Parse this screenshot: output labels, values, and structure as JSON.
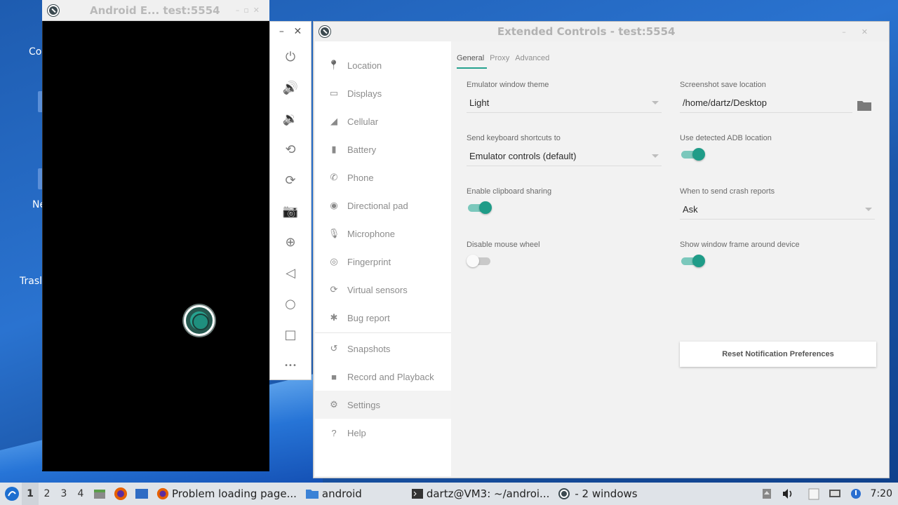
{
  "desktop": {
    "icon_labels": [
      "Co",
      "Ne",
      "Trasl"
    ]
  },
  "emulator": {
    "title": "Android E... test:5554",
    "toolbar": {
      "minimize": "–",
      "close": "✕",
      "buttons": [
        {
          "name": "power-icon",
          "glyph": "⏻"
        },
        {
          "name": "volume-up-icon",
          "glyph": "🔊"
        },
        {
          "name": "volume-down-icon",
          "glyph": "🔉"
        },
        {
          "name": "rotate-left-icon",
          "glyph": "⟲"
        },
        {
          "name": "rotate-right-icon",
          "glyph": "⟳"
        },
        {
          "name": "camera-icon",
          "glyph": "📷"
        },
        {
          "name": "zoom-icon",
          "glyph": "⊕"
        },
        {
          "name": "back-icon",
          "glyph": "◁"
        },
        {
          "name": "home-icon",
          "glyph": "○"
        },
        {
          "name": "overview-icon",
          "glyph": "□"
        },
        {
          "name": "more-icon",
          "glyph": "•••"
        }
      ]
    }
  },
  "extended": {
    "title": "Extended Controls - test:5554",
    "nav": [
      {
        "label": "Location",
        "icon": "location-icon",
        "glyph": "📍"
      },
      {
        "label": "Displays",
        "icon": "display-icon",
        "glyph": "▭"
      },
      {
        "label": "Cellular",
        "icon": "signal-icon",
        "glyph": "◢"
      },
      {
        "label": "Battery",
        "icon": "battery-icon",
        "glyph": "▮"
      },
      {
        "label": "Phone",
        "icon": "phone-icon",
        "glyph": "✆"
      },
      {
        "label": "Directional pad",
        "icon": "dpad-icon",
        "glyph": "◉"
      },
      {
        "label": "Microphone",
        "icon": "microphone-icon",
        "glyph": "🎙"
      },
      {
        "label": "Fingerprint",
        "icon": "fingerprint-icon",
        "glyph": "◎"
      },
      {
        "label": "Virtual sensors",
        "icon": "sensors-icon",
        "glyph": "⟳"
      },
      {
        "label": "Bug report",
        "icon": "bug-icon",
        "glyph": "✱"
      },
      {
        "label": "Snapshots",
        "icon": "snapshot-icon",
        "glyph": "↺"
      },
      {
        "label": "Record and Playback",
        "icon": "record-icon",
        "glyph": "■"
      },
      {
        "label": "Settings",
        "icon": "gear-icon",
        "glyph": "⚙"
      },
      {
        "label": "Help",
        "icon": "help-icon",
        "glyph": "?"
      }
    ],
    "active_nav": "Settings",
    "tabs": [
      "General",
      "Proxy",
      "Advanced"
    ],
    "active_tab": "General",
    "settings": {
      "theme_label": "Emulator window theme",
      "theme_value": "Light",
      "screenshot_label": "Screenshot save location",
      "screenshot_value": "/home/dartz/Desktop",
      "shortcuts_label": "Send keyboard shortcuts to",
      "shortcuts_value": "Emulator controls (default)",
      "adb_label": "Use detected ADB location",
      "adb_on": true,
      "clipboard_label": "Enable clipboard sharing",
      "clipboard_on": true,
      "crash_label": "When to send crash reports",
      "crash_value": "Ask",
      "mousewheel_label": "Disable mouse wheel",
      "mousewheel_on": false,
      "frame_label": "Show window frame around device",
      "frame_on": true,
      "reset_label": "Reset Notification Preferences"
    }
  },
  "taskbar": {
    "workspaces": [
      "1",
      "2",
      "3",
      "4"
    ],
    "active_workspace": "1",
    "tasks": [
      "Problem loading page...",
      "android",
      "dartz@VM3: ~/androi...",
      "- 2 windows"
    ],
    "clock": "7:20"
  },
  "colors": {
    "accent": "#26a28f",
    "desktop": "#2a73d0"
  }
}
